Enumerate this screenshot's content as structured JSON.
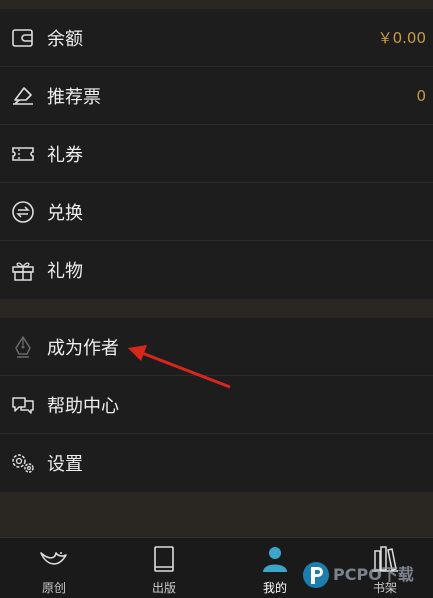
{
  "wallet": {
    "items": [
      {
        "icon": "wallet-icon",
        "label": "余额",
        "value": "￥0.00"
      },
      {
        "icon": "recommend-ticket-icon",
        "label": "推荐票",
        "value": "0"
      },
      {
        "icon": "coupon-icon",
        "label": "礼券",
        "value": ""
      },
      {
        "icon": "exchange-icon",
        "label": "兑换",
        "value": ""
      },
      {
        "icon": "gift-icon",
        "label": "礼物",
        "value": ""
      }
    ]
  },
  "more": {
    "items": [
      {
        "icon": "pen-nib-icon",
        "label": "成为作者"
      },
      {
        "icon": "help-chat-icon",
        "label": "帮助中心"
      },
      {
        "icon": "settings-gears-icon",
        "label": "设置"
      }
    ]
  },
  "tabbar": {
    "tabs": [
      {
        "icon": "bird-icon",
        "label": "原创",
        "active": false
      },
      {
        "icon": "book-icon",
        "label": "出版",
        "active": false
      },
      {
        "icon": "user-icon",
        "label": "我的",
        "active": true
      },
      {
        "icon": "bookshelf-icon",
        "label": "书架",
        "active": false
      }
    ]
  },
  "watermark": {
    "text": "PCPO下载"
  },
  "colors": {
    "accent": "#c79a48",
    "active_tab": "#3aa7c9",
    "annotation_arrow": "#d8261c"
  }
}
